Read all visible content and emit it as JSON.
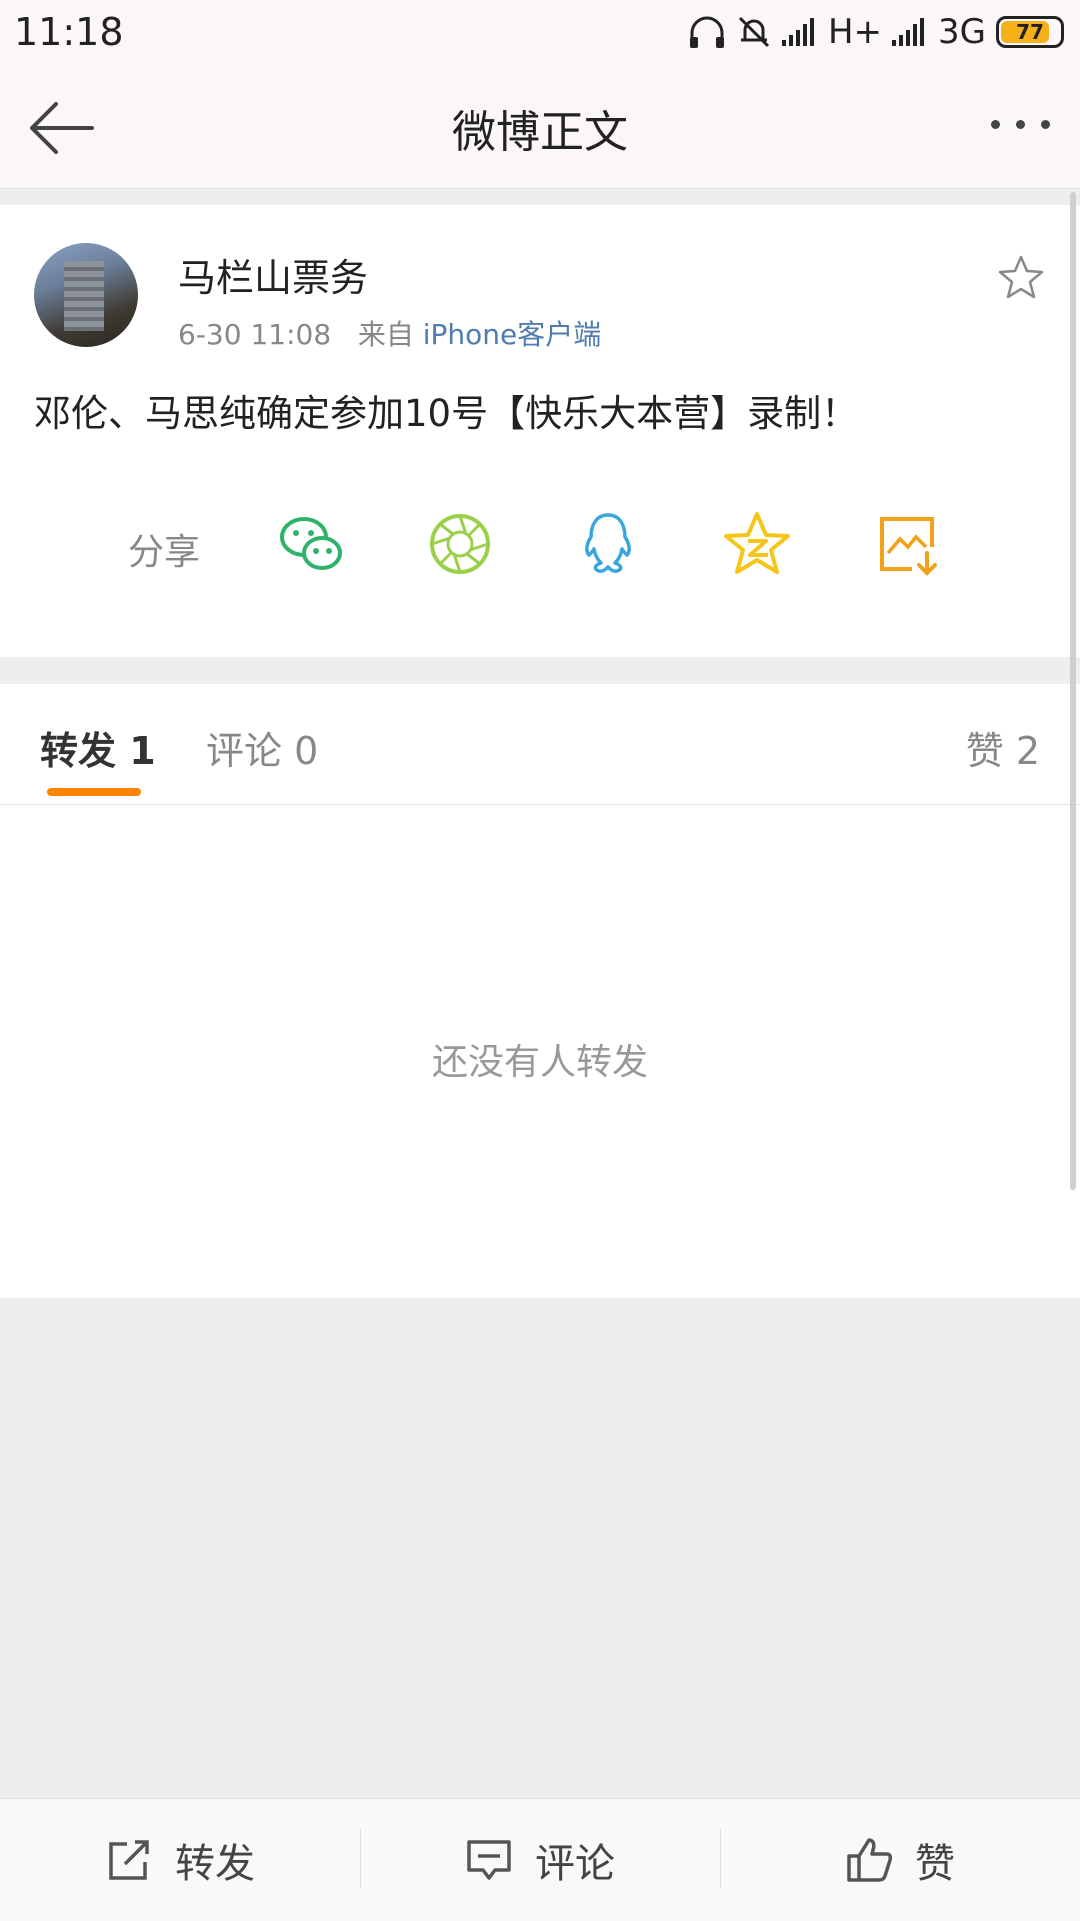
{
  "status_bar": {
    "time": "11:18",
    "network1": "H+",
    "network2": "3G",
    "battery": "77"
  },
  "nav": {
    "title": "微博正文"
  },
  "post": {
    "author": "马栏山票务",
    "time": "6-30 11:08",
    "source_prefix": "来自",
    "source": "iPhone客户端",
    "text": "邓伦、马思纯确定参加10号【快乐大本营】录制！"
  },
  "share": {
    "label": "分享",
    "icons": [
      "wechat-icon",
      "moments-icon",
      "qq-icon",
      "qzone-icon",
      "save-image-icon"
    ]
  },
  "tabs": {
    "repost": "转发 1",
    "comment": "评论 0",
    "like": "赞 2"
  },
  "empty": {
    "text": "还没有人转发"
  },
  "toolbar": {
    "repost": "转发",
    "comment": "评论",
    "like": "赞"
  },
  "colors": {
    "accent": "#ff8200",
    "link": "#507daf"
  }
}
